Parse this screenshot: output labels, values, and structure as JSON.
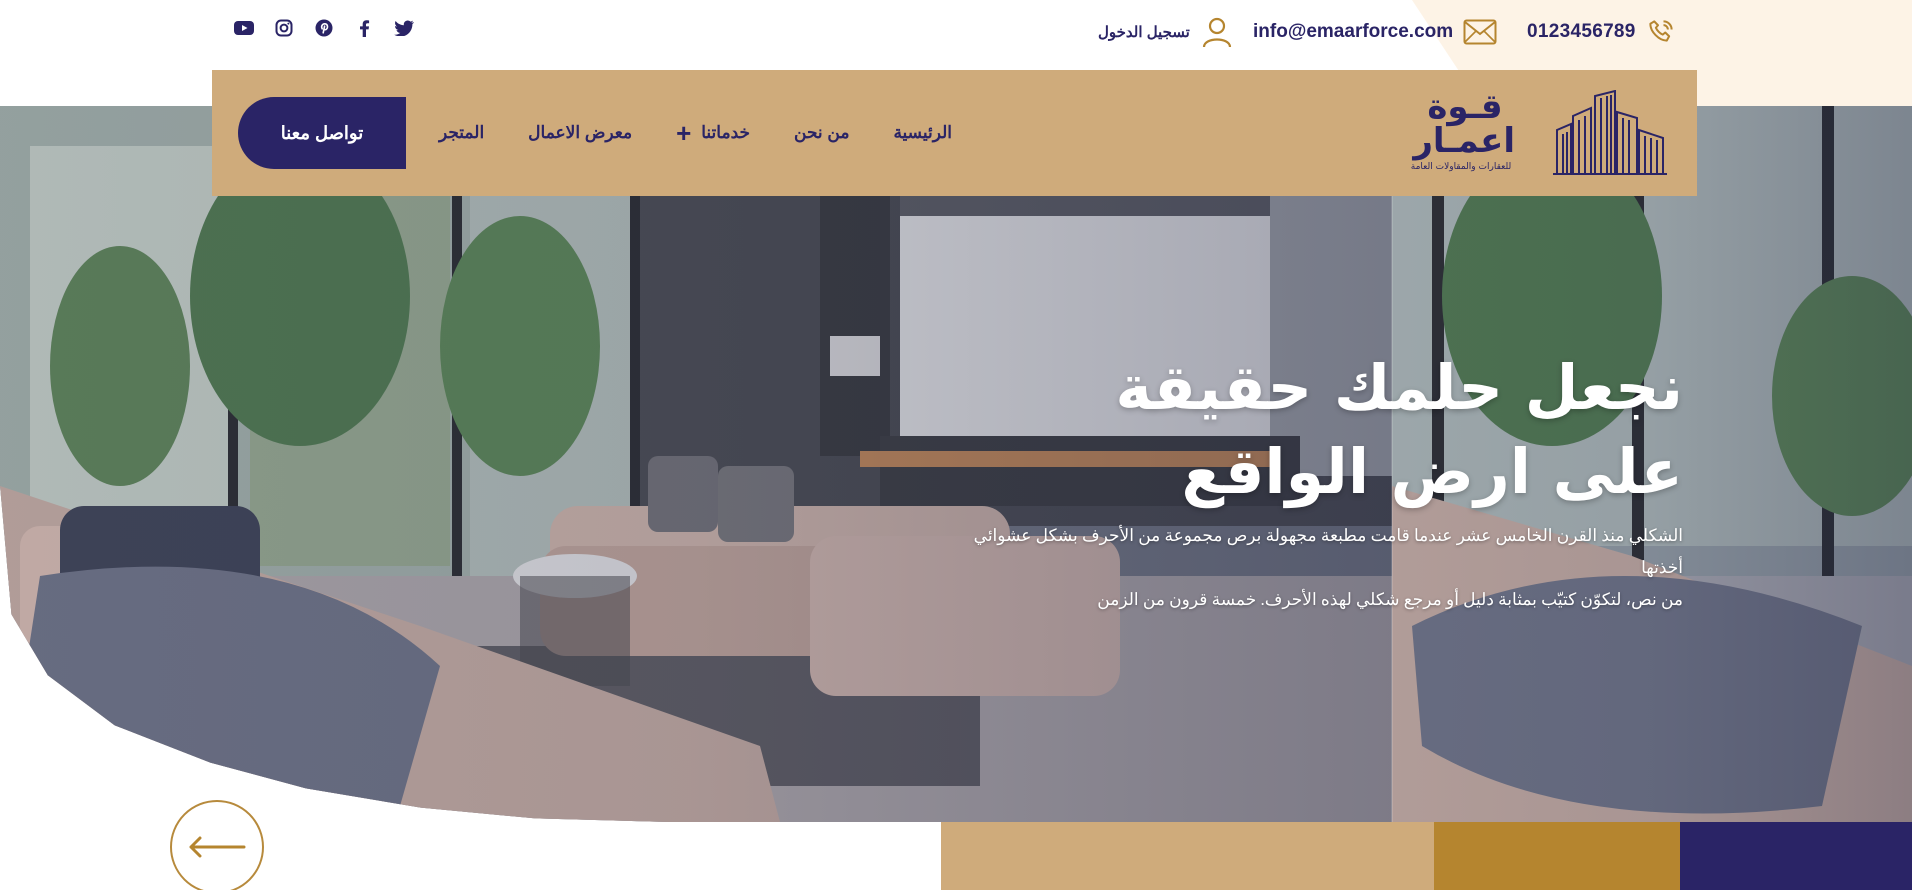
{
  "topbar": {
    "phone": "0123456789",
    "email": "info@emaarforce.com",
    "login_label": "تسجيل الدخول",
    "socials": [
      {
        "name": "twitter",
        "icon": "twitter-icon"
      },
      {
        "name": "facebook",
        "icon": "facebook-icon"
      },
      {
        "name": "pinterest",
        "icon": "pinterest-icon"
      },
      {
        "name": "instagram",
        "icon": "instagram-icon"
      },
      {
        "name": "youtube",
        "icon": "youtube-icon"
      }
    ]
  },
  "brand": {
    "logo_line1": "قـوة",
    "logo_line2": "اعمـار",
    "logo_tagline": "للعقارات والمقاولات العامة"
  },
  "nav": {
    "items": [
      "الرئيسية",
      "من نحن",
      "خدماتنا",
      "معرض الاعمال",
      "المتجر"
    ],
    "services_expand_icon": "plus-icon",
    "cta_label": "تواصل معنا"
  },
  "hero": {
    "title_line1": "نجعل حلمك حقيقة",
    "title_line2": "على ارض الواقع",
    "description_line1": "الشكلي منذ القرن الخامس عشر عندما قامت مطبعة مجهولة برص مجموعة من الأحرف بشكل عشوائي أخذتها",
    "description_line2": "من نص، لتكوّن كتيّب بمثابة دليل أو مرجع شكلي لهذه الأحرف. خمسة قرون من الزمن"
  },
  "slider": {
    "prev_icon": "arrow-left-icon"
  },
  "colors": {
    "navy": "#2a2466",
    "gold": "#cfab7b",
    "dark_gold": "#b5852f",
    "cream": "#fdf3e6"
  }
}
